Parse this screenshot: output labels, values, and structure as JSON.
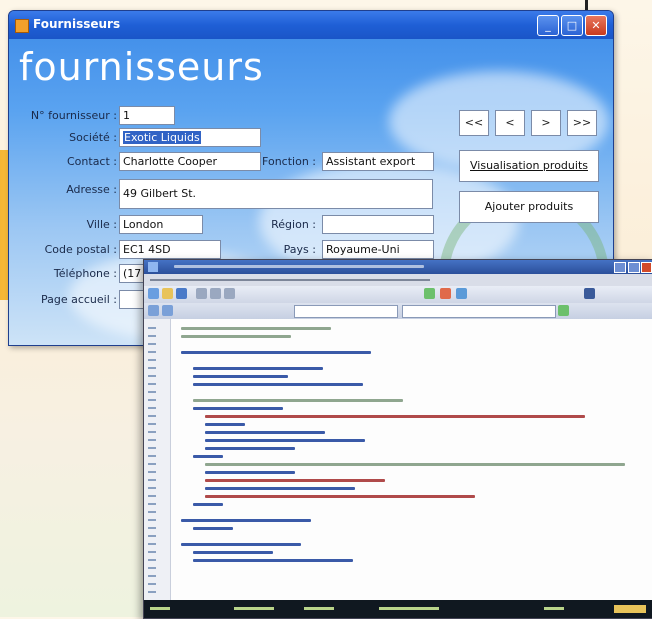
{
  "window": {
    "title": "Fournisseurs",
    "heading": "fournisseurs",
    "controls": {
      "minimize": "_",
      "maximize": "□",
      "close": "✕"
    }
  },
  "form": {
    "supplier_no_label": "N° fournisseur :",
    "supplier_no": "1",
    "company_label": "Société :",
    "company": "Exotic Liquids",
    "contact_label": "Contact :",
    "contact": "Charlotte Cooper",
    "function_label": "Fonction :",
    "function": "Assistant export",
    "address_label": "Adresse :",
    "address": "49 Gilbert St.",
    "city_label": "Ville :",
    "city": "London",
    "region_label": "Région :",
    "region": "",
    "postal_label": "Code postal :",
    "postal": "EC1 4SD",
    "country_label": "Pays :",
    "country": "Royaume-Uni",
    "phone_label": "Téléphone :",
    "phone": "(17",
    "homepage_label": "Page accueil :",
    "homepage": ""
  },
  "nav": {
    "first": "<<",
    "prev": "<",
    "next": ">",
    "last": ">>"
  },
  "actions": {
    "view_products": "Visualisation produits",
    "add_products": "Ajouter produits"
  },
  "colors": {
    "accent": "#1f5fd6",
    "selection": "#3163c5",
    "arrow": "#f6b634"
  }
}
